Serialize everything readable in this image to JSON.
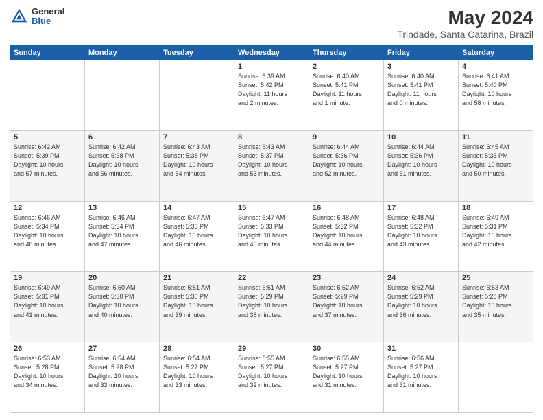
{
  "header": {
    "logo_general": "General",
    "logo_blue": "Blue",
    "main_title": "May 2024",
    "subtitle": "Trindade, Santa Catarina, Brazil"
  },
  "weekdays": [
    "Sunday",
    "Monday",
    "Tuesday",
    "Wednesday",
    "Thursday",
    "Friday",
    "Saturday"
  ],
  "weeks": [
    [
      {
        "num": "",
        "info": ""
      },
      {
        "num": "",
        "info": ""
      },
      {
        "num": "",
        "info": ""
      },
      {
        "num": "1",
        "info": "Sunrise: 6:39 AM\nSunset: 5:42 PM\nDaylight: 11 hours\nand 2 minutes."
      },
      {
        "num": "2",
        "info": "Sunrise: 6:40 AM\nSunset: 5:41 PM\nDaylight: 11 hours\nand 1 minute."
      },
      {
        "num": "3",
        "info": "Sunrise: 6:40 AM\nSunset: 5:41 PM\nDaylight: 11 hours\nand 0 minutes."
      },
      {
        "num": "4",
        "info": "Sunrise: 6:41 AM\nSunset: 5:40 PM\nDaylight: 10 hours\nand 58 minutes."
      }
    ],
    [
      {
        "num": "5",
        "info": "Sunrise: 6:42 AM\nSunset: 5:39 PM\nDaylight: 10 hours\nand 57 minutes."
      },
      {
        "num": "6",
        "info": "Sunrise: 6:42 AM\nSunset: 5:38 PM\nDaylight: 10 hours\nand 56 minutes."
      },
      {
        "num": "7",
        "info": "Sunrise: 6:43 AM\nSunset: 5:38 PM\nDaylight: 10 hours\nand 54 minutes."
      },
      {
        "num": "8",
        "info": "Sunrise: 6:43 AM\nSunset: 5:37 PM\nDaylight: 10 hours\nand 53 minutes."
      },
      {
        "num": "9",
        "info": "Sunrise: 6:44 AM\nSunset: 5:36 PM\nDaylight: 10 hours\nand 52 minutes."
      },
      {
        "num": "10",
        "info": "Sunrise: 6:44 AM\nSunset: 5:36 PM\nDaylight: 10 hours\nand 51 minutes."
      },
      {
        "num": "11",
        "info": "Sunrise: 6:45 AM\nSunset: 5:35 PM\nDaylight: 10 hours\nand 50 minutes."
      }
    ],
    [
      {
        "num": "12",
        "info": "Sunrise: 6:46 AM\nSunset: 5:34 PM\nDaylight: 10 hours\nand 48 minutes."
      },
      {
        "num": "13",
        "info": "Sunrise: 6:46 AM\nSunset: 5:34 PM\nDaylight: 10 hours\nand 47 minutes."
      },
      {
        "num": "14",
        "info": "Sunrise: 6:47 AM\nSunset: 5:33 PM\nDaylight: 10 hours\nand 46 minutes."
      },
      {
        "num": "15",
        "info": "Sunrise: 6:47 AM\nSunset: 5:33 PM\nDaylight: 10 hours\nand 45 minutes."
      },
      {
        "num": "16",
        "info": "Sunrise: 6:48 AM\nSunset: 5:32 PM\nDaylight: 10 hours\nand 44 minutes."
      },
      {
        "num": "17",
        "info": "Sunrise: 6:48 AM\nSunset: 5:32 PM\nDaylight: 10 hours\nand 43 minutes."
      },
      {
        "num": "18",
        "info": "Sunrise: 6:49 AM\nSunset: 5:31 PM\nDaylight: 10 hours\nand 42 minutes."
      }
    ],
    [
      {
        "num": "19",
        "info": "Sunrise: 6:49 AM\nSunset: 5:31 PM\nDaylight: 10 hours\nand 41 minutes."
      },
      {
        "num": "20",
        "info": "Sunrise: 6:50 AM\nSunset: 5:30 PM\nDaylight: 10 hours\nand 40 minutes."
      },
      {
        "num": "21",
        "info": "Sunrise: 6:51 AM\nSunset: 5:30 PM\nDaylight: 10 hours\nand 39 minutes."
      },
      {
        "num": "22",
        "info": "Sunrise: 6:51 AM\nSunset: 5:29 PM\nDaylight: 10 hours\nand 38 minutes."
      },
      {
        "num": "23",
        "info": "Sunrise: 6:52 AM\nSunset: 5:29 PM\nDaylight: 10 hours\nand 37 minutes."
      },
      {
        "num": "24",
        "info": "Sunrise: 6:52 AM\nSunset: 5:29 PM\nDaylight: 10 hours\nand 36 minutes."
      },
      {
        "num": "25",
        "info": "Sunrise: 6:53 AM\nSunset: 5:28 PM\nDaylight: 10 hours\nand 35 minutes."
      }
    ],
    [
      {
        "num": "26",
        "info": "Sunrise: 6:53 AM\nSunset: 5:28 PM\nDaylight: 10 hours\nand 34 minutes."
      },
      {
        "num": "27",
        "info": "Sunrise: 6:54 AM\nSunset: 5:28 PM\nDaylight: 10 hours\nand 33 minutes."
      },
      {
        "num": "28",
        "info": "Sunrise: 6:54 AM\nSunset: 5:27 PM\nDaylight: 10 hours\nand 33 minutes."
      },
      {
        "num": "29",
        "info": "Sunrise: 6:55 AM\nSunset: 5:27 PM\nDaylight: 10 hours\nand 32 minutes."
      },
      {
        "num": "30",
        "info": "Sunrise: 6:55 AM\nSunset: 5:27 PM\nDaylight: 10 hours\nand 31 minutes."
      },
      {
        "num": "31",
        "info": "Sunrise: 6:56 AM\nSunset: 5:27 PM\nDaylight: 10 hours\nand 31 minutes."
      },
      {
        "num": "",
        "info": ""
      }
    ]
  ]
}
